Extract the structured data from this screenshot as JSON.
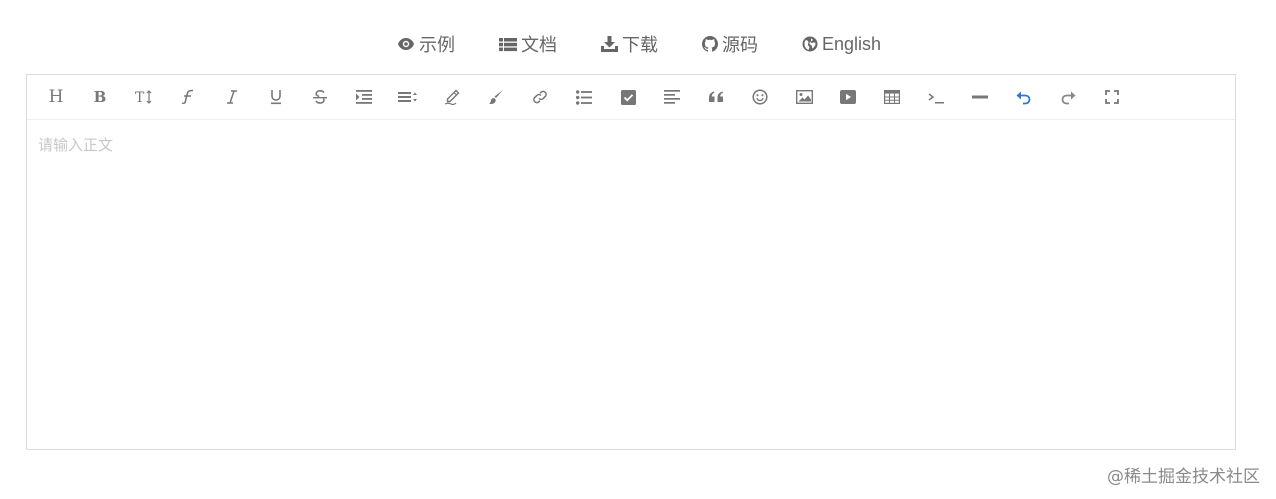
{
  "nav": {
    "items": [
      {
        "icon": "eye-icon",
        "label": "示例"
      },
      {
        "icon": "list-icon",
        "label": "文档"
      },
      {
        "icon": "download-icon",
        "label": "下载"
      },
      {
        "icon": "github-icon",
        "label": "源码"
      },
      {
        "icon": "globe-icon",
        "label": "English"
      }
    ]
  },
  "toolbar": {
    "heading_glyph": "H",
    "bold_glyph": "B",
    "items": [
      "heading-icon",
      "bold-icon",
      "font-size-icon",
      "font-family-icon",
      "italic-icon",
      "underline-icon",
      "strikethrough-icon",
      "indent-icon",
      "line-height-icon",
      "text-color-icon",
      "background-color-icon",
      "link-icon",
      "unordered-list-icon",
      "todo-checkbox-icon",
      "align-left-icon",
      "blockquote-icon",
      "emoji-icon",
      "image-icon",
      "video-icon",
      "table-icon",
      "code-icon",
      "divider-icon",
      "undo-icon",
      "redo-icon",
      "fullscreen-icon"
    ],
    "undo_color": "#2a7ad5"
  },
  "editor": {
    "placeholder": "请输入正文"
  },
  "watermark": "@稀土掘金技术社区"
}
